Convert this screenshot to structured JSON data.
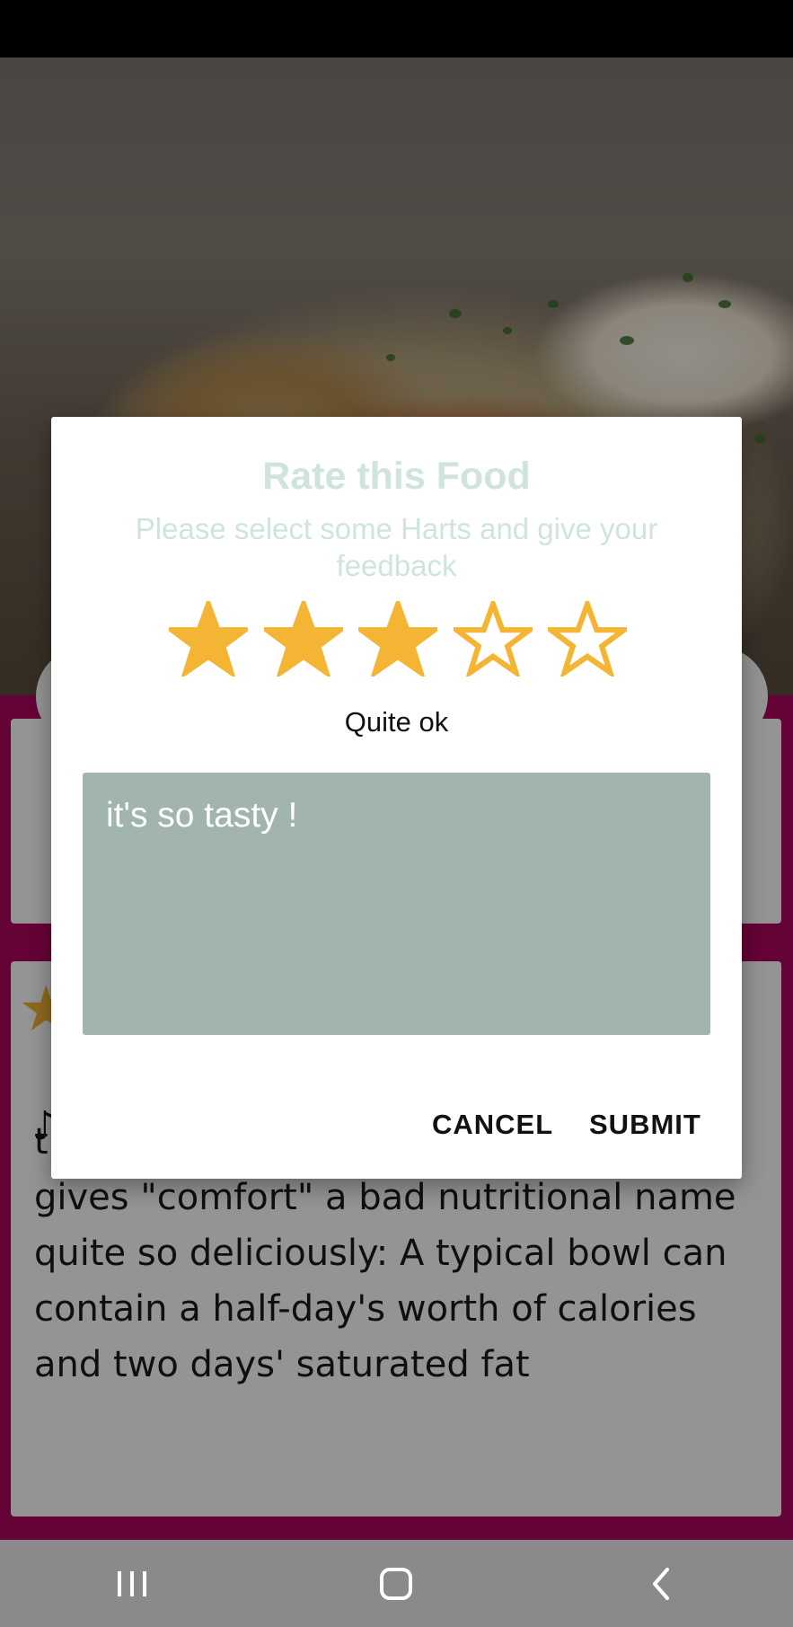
{
  "dialog": {
    "title": "Rate this Food",
    "subtitle": "Please select some Harts and give your feedback",
    "rating": {
      "selected": 3,
      "max": 5,
      "label": "Quite ok"
    },
    "feedback_text": "it's so tasty !",
    "cancel_label": "CANCEL",
    "submit_label": "SUBMIT"
  },
  "background": {
    "description_note": "♪",
    "description": "than mac and cheese, and nothing gives \"comfort\" a bad nutritional name quite so deliciously: A typical bowl can contain a half-day's worth of calories and two days' saturated fat"
  },
  "nav": {
    "recents": "recents-icon",
    "home": "home-icon",
    "back": "back-icon"
  },
  "colors": {
    "star": "#f5b534",
    "accent_page": "#b0065e",
    "feedback_bg": "#a2b5ad",
    "title_text": "#cfe4de"
  }
}
